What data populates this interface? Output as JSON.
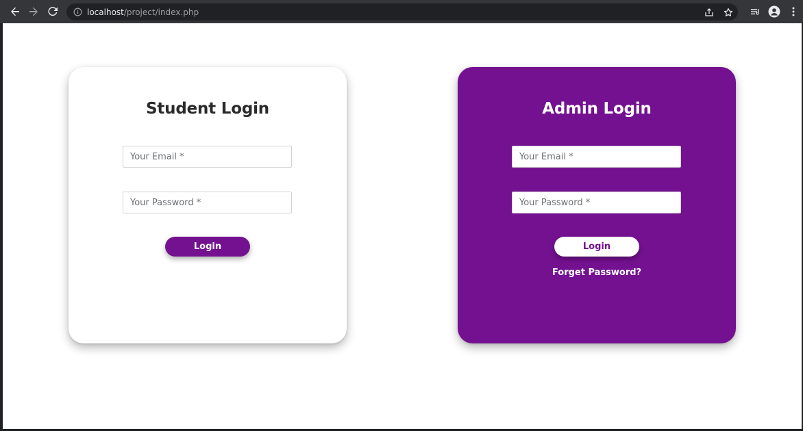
{
  "browser": {
    "url_host": "localhost",
    "url_path": "/project/index.php",
    "icons": [
      "back-icon",
      "forward-icon",
      "reload-icon",
      "info-icon",
      "share-icon",
      "star-icon",
      "reading-list-icon",
      "profile-icon",
      "menu-icon"
    ]
  },
  "student": {
    "title": "Student Login",
    "email_placeholder": "Your Email *",
    "password_placeholder": "Your Password *",
    "login_label": "Login"
  },
  "admin": {
    "title": "Admin Login",
    "email_placeholder": "Your Email *",
    "password_placeholder": "Your Password *",
    "login_label": "Login",
    "forgot_label": "Forget Password?"
  },
  "colors": {
    "brand_purple": "#741190",
    "toolbar_bg": "#35363a",
    "page_bg": "#ffffff"
  }
}
